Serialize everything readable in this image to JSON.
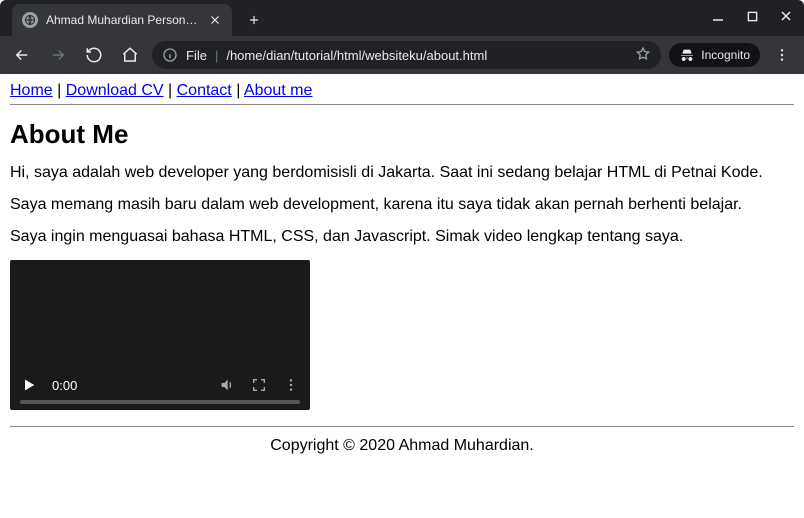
{
  "browser": {
    "tab_title": "Ahmad Muhardian Personal W",
    "url_scheme": "File",
    "url_path": "/home/dian/tutorial/html/websiteku/about.html",
    "incognito_label": "Incognito"
  },
  "nav": {
    "home": "Home",
    "download_cv": "Download CV",
    "contact": "Contact",
    "about": "About me",
    "sep": " | "
  },
  "page": {
    "heading": "About Me",
    "p1": "Hi, saya adalah web developer yang berdomisisli di Jakarta. Saat ini sedang belajar HTML di Petnai Kode.",
    "p2": "Saya memang masih baru dalam web development, karena itu saya tidak akan pernah berhenti belajar.",
    "p3": "Saya ingin menguasai bahasa HTML, CSS, dan Javascript. Simak video lengkap tentang saya."
  },
  "video": {
    "time": "0:00"
  },
  "footer": {
    "text": "Copyright © 2020 Ahmad Muhardian."
  }
}
